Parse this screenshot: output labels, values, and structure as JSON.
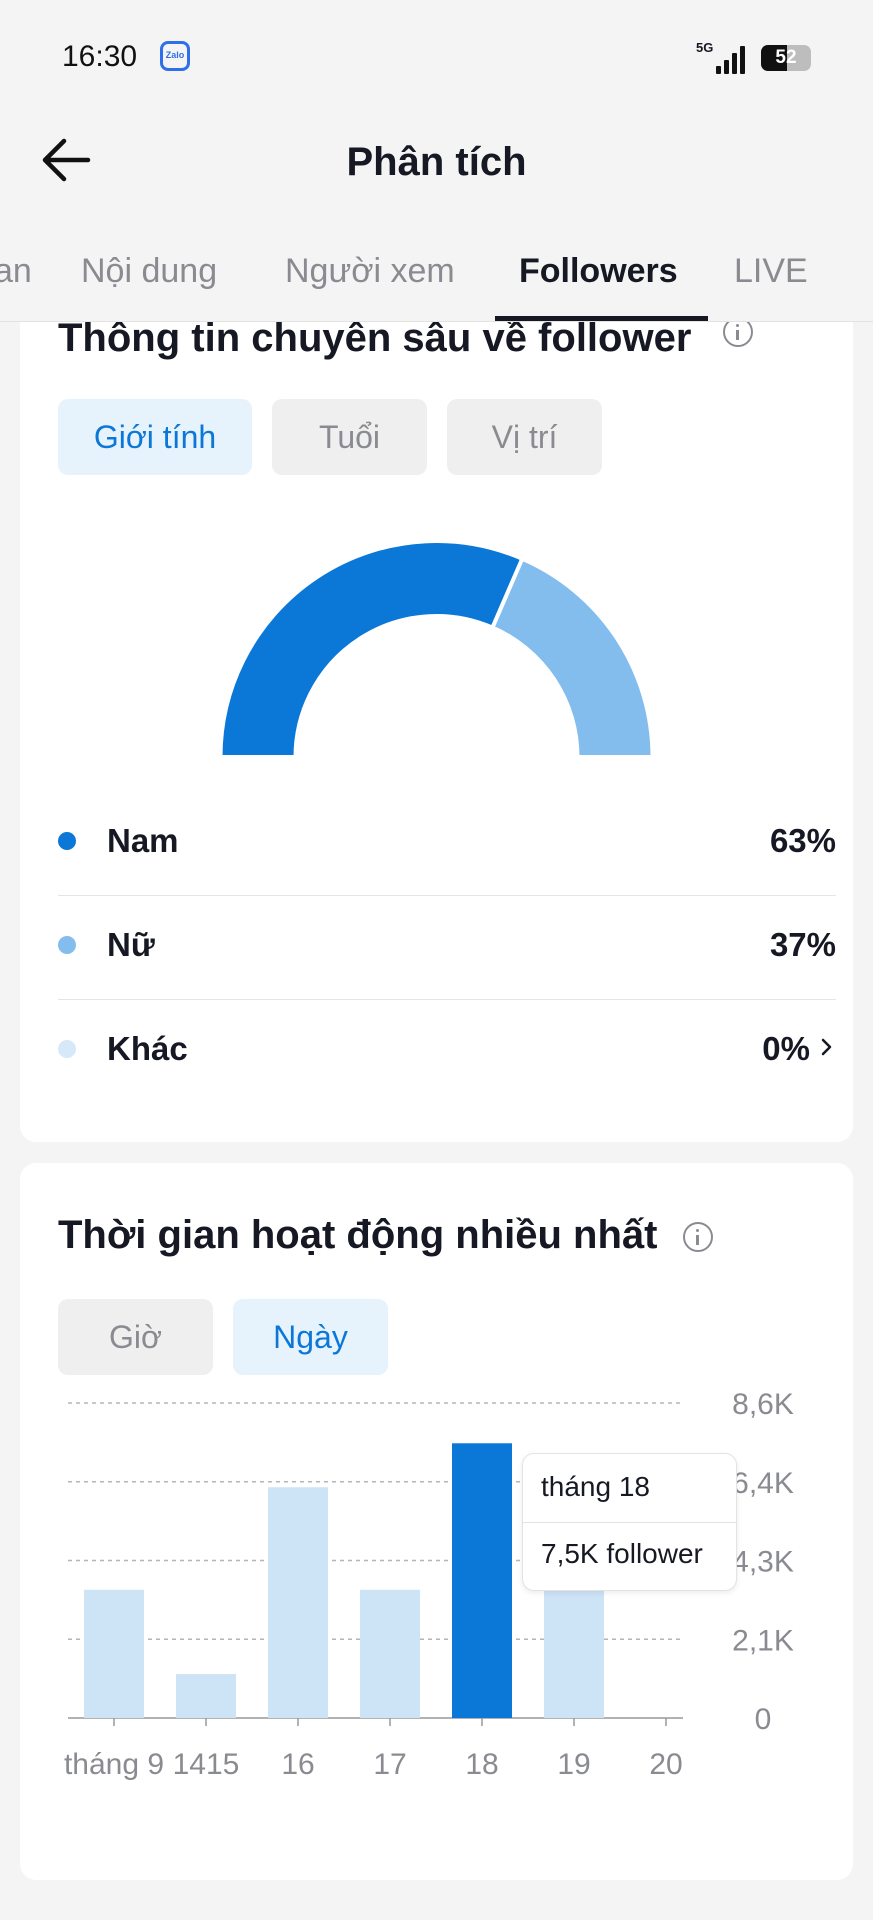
{
  "status_bar": {
    "time": "16:30",
    "app_badge": "Zalo",
    "network": "5G",
    "battery": "52",
    "battery_level": 0.52
  },
  "header": {
    "title": "Phân tích",
    "back_icon": "arrow-left-icon"
  },
  "tabs": [
    {
      "label": "an",
      "active": false
    },
    {
      "label": "Nội dung",
      "active": false
    },
    {
      "label": "Người xem",
      "active": false
    },
    {
      "label": "Followers",
      "active": true
    },
    {
      "label": "LIVE",
      "active": false
    }
  ],
  "insights": {
    "title": "Thông tin chuyên sâu về follower",
    "filters": [
      {
        "label": "Giới tính",
        "active": true
      },
      {
        "label": "Tuổi",
        "active": false
      },
      {
        "label": "Vị trí",
        "active": false
      }
    ],
    "gender": [
      {
        "label": "Nam",
        "value": "63%",
        "pct": 63,
        "color": "#0b78d8"
      },
      {
        "label": "Nữ",
        "value": "37%",
        "pct": 37,
        "color": "#82bdee"
      },
      {
        "label": "Khác",
        "value": "0%",
        "pct": 0,
        "color": "#d7e8f8"
      }
    ]
  },
  "activity": {
    "title": "Thời gian hoạt động nhiều nhất",
    "filters": [
      {
        "label": "Giờ",
        "active": false
      },
      {
        "label": "Ngày",
        "active": true
      }
    ],
    "tooltip": {
      "label": "tháng 18",
      "value": "7,5K follower"
    }
  },
  "chart_data": {
    "type": "bar",
    "categories": [
      "tháng 9",
      "14",
      "15",
      "16",
      "17",
      "18",
      "19",
      "20"
    ],
    "tick_labels": [
      "tháng 9",
      "1415",
      "16",
      "17",
      "18",
      "19",
      "20"
    ],
    "values": [
      null,
      3500,
      1200,
      6300,
      3500,
      7500,
      3500,
      0
    ],
    "highlight_index": 5,
    "ylim": [
      0,
      8600
    ],
    "y_ticks": [
      "0",
      "2,1K",
      "4,3K",
      "6,4K",
      "8,6K"
    ],
    "y_tick_values": [
      0,
      2150,
      4300,
      6450,
      8600
    ],
    "grid": true,
    "colors": {
      "bar": "#cde3f6",
      "highlight": "#0b78d8"
    }
  }
}
